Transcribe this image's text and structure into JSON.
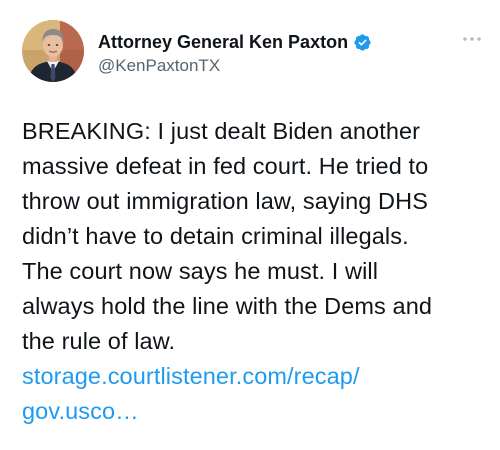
{
  "tweet": {
    "author": {
      "display_name": "Attorney General Ken Paxton",
      "handle": "@KenPaxtonTX",
      "verified": true
    },
    "body_lines": [
      "BREAKING: I just dealt Biden another",
      "massive defeat in fed court. He tried to",
      "throw out immigration law, saying DHS",
      "didn’t have to detain criminal illegals.",
      "The court now says he must. I will",
      "always hold the line with the Dems and",
      "the rule of law."
    ],
    "link_lines": [
      "storage.courtlistener.com/recap/",
      "gov.usco…"
    ]
  },
  "colors": {
    "text": "#0f1419",
    "secondary": "#536471",
    "link": "#1d9bf0",
    "verified_badge": "#1d9bf0"
  },
  "icons": {
    "verified": "verified-badge-icon",
    "more": "more-options-icon"
  }
}
